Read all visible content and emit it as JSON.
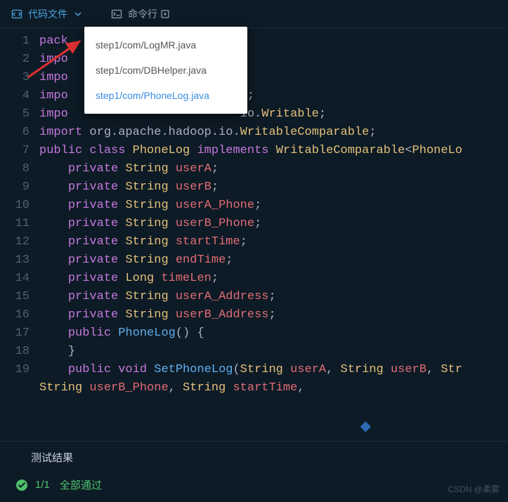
{
  "tabs": {
    "code": {
      "label": "代码文件"
    },
    "terminal": {
      "label": "命令行"
    }
  },
  "dropdown": {
    "items": [
      {
        "label": "step1/com/LogMR.java"
      },
      {
        "label": "step1/com/DBHelper.java"
      },
      {
        "label": "step1/com/PhoneLog.java"
      }
    ]
  },
  "code": {
    "lines": [
      {
        "n": "1",
        "html": "<span class='kw'>pack</span>"
      },
      {
        "n": "2",
        "html": "<span class='kw'>impo</span>"
      },
      {
        "n": "3",
        "html": "<span class='kw'>impo</span>"
      },
      {
        "n": "4",
        "html": "<span class='kw'>impo</span>                        <span class='plain'>n;</span>"
      },
      {
        "n": "5",
        "html": "<span class='kw'>impo</span>                        <span class='plain'>io.</span><span class='type'>Writable</span><span class='plain'>;</span>"
      },
      {
        "n": "6",
        "html": "<span class='kw'>import</span> <span class='pkg'>org.apache.hadoop.io.</span><span class='type'>WritableComparable</span><span class='plain'>;</span>"
      },
      {
        "n": "7",
        "html": "<span class='kw'>public</span> <span class='kw'>class</span> <span class='type'>PhoneLog</span> <span class='kw'>implements</span> <span class='type'>WritableComparable</span><span class='plain'>&lt;</span><span class='type'>PhoneLo</span>"
      },
      {
        "n": "8",
        "html": "    <span class='kw'>private</span> <span class='type'>String</span> <span class='ident'>userA</span><span class='plain'>;</span>"
      },
      {
        "n": "9",
        "html": "    <span class='kw'>private</span> <span class='type'>String</span> <span class='ident'>userB</span><span class='plain'>;</span>"
      },
      {
        "n": "10",
        "html": "    <span class='kw'>private</span> <span class='type'>String</span> <span class='ident'>userA_Phone</span><span class='plain'>;</span>"
      },
      {
        "n": "11",
        "html": "    <span class='kw'>private</span> <span class='type'>String</span> <span class='ident'>userB_Phone</span><span class='plain'>;</span>"
      },
      {
        "n": "12",
        "html": "    <span class='kw'>private</span> <span class='type'>String</span> <span class='ident'>startTime</span><span class='plain'>;</span>"
      },
      {
        "n": "13",
        "html": "    <span class='kw'>private</span> <span class='type'>String</span> <span class='ident'>endTime</span><span class='plain'>;</span>"
      },
      {
        "n": "14",
        "html": "    <span class='kw'>private</span> <span class='type'>Long</span> <span class='ident'>timeLen</span><span class='plain'>;</span>"
      },
      {
        "n": "15",
        "html": "    <span class='kw'>private</span> <span class='type'>String</span> <span class='ident'>userA_Address</span><span class='plain'>;</span>"
      },
      {
        "n": "16",
        "html": "    <span class='kw'>private</span> <span class='type'>String</span> <span class='ident'>userB_Address</span><span class='plain'>;</span>"
      },
      {
        "n": "17",
        "html": "    <span class='kw'>public</span> <span class='fn'>PhoneLog</span><span class='plain'>() {</span>"
      },
      {
        "n": "18",
        "html": "    <span class='plain'>}</span>"
      },
      {
        "n": "19",
        "html": "    <span class='kw'>public</span> <span class='kw'>void</span> <span class='fn'>SetPhoneLog</span><span class='plain'>(</span><span class='type'>String</span> <span class='ident'>userA</span><span class='plain'>, </span><span class='type'>String</span> <span class='ident'>userB</span><span class='plain'>, </span><span class='type'>Str</span>"
      },
      {
        "n": "",
        "html": "<span class='type'>String</span> <span class='ident'>userB_Phone</span><span class='plain'>, </span><span class='type'>String</span> <span class='ident'>startTime</span><span class='plain'>,</span>"
      }
    ]
  },
  "results": {
    "title": "测试结果",
    "score": "1/1",
    "status": "全部通过"
  },
  "watermark": "CSDN @柔雾"
}
